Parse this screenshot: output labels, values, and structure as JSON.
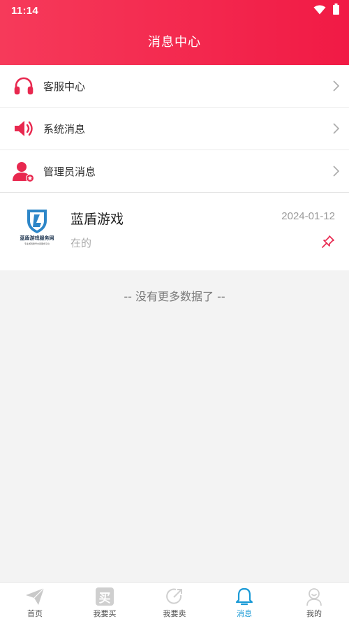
{
  "status_bar": {
    "time": "11:14"
  },
  "header": {
    "title": "消息中心"
  },
  "menu": {
    "items": [
      {
        "label": "客服中心",
        "icon": "headset-icon"
      },
      {
        "label": "系统消息",
        "icon": "speaker-icon"
      },
      {
        "label": "管理员消息",
        "icon": "admin-user-icon"
      }
    ]
  },
  "conversation": {
    "name": "蓝盾游戏",
    "date": "2024-01-12",
    "preview": "在的",
    "logo_text": "蓝盾游戏服务网",
    "logo_subtext": "专业游戏账号交易服务平台"
  },
  "empty_state": {
    "text": "-- 没有更多数据了 --"
  },
  "tabbar": {
    "tabs": [
      {
        "label": "首页",
        "icon": "paper-plane-icon",
        "active": false
      },
      {
        "label": "我要买",
        "icon": "buy-icon",
        "active": false
      },
      {
        "label": "我要卖",
        "icon": "sell-icon",
        "active": false
      },
      {
        "label": "消息",
        "icon": "bell-icon",
        "active": true
      },
      {
        "label": "我的",
        "icon": "profile-icon",
        "active": false
      }
    ],
    "buy_glyph": "买"
  },
  "colors": {
    "header_start": "#f63a5a",
    "header_end": "#f11a45",
    "accent_red": "#e8284f",
    "active_tab": "#1a9ad6",
    "logo_blue": "#2d86c8"
  }
}
